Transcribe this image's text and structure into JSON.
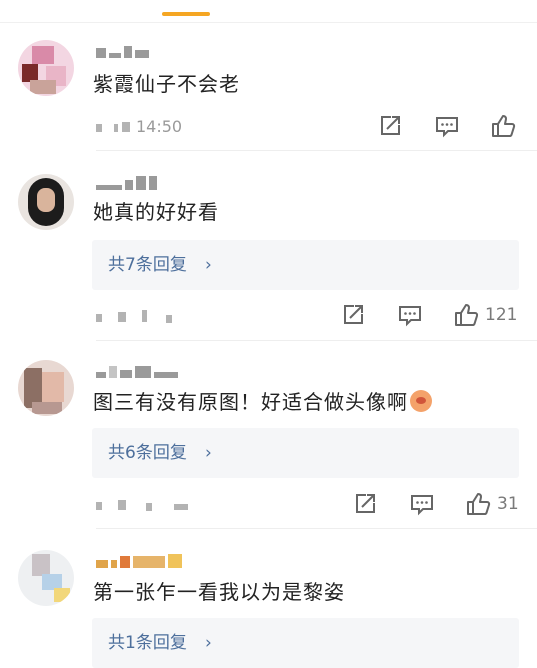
{
  "comments": [
    {
      "text": "紫霞仙子不会老",
      "time": "14:50",
      "replies_label": "",
      "likes": ""
    },
    {
      "text": "她真的好好看",
      "time": "",
      "replies_label": "共7条回复",
      "likes": "121"
    },
    {
      "text": "图三有没有原图！好适合做头像啊",
      "time": "",
      "replies_label": "共6条回复",
      "likes": "31"
    },
    {
      "text": "第一张乍一看我以为是黎姿",
      "time": "",
      "replies_label": "共1条回复",
      "likes": ""
    }
  ],
  "icons": {
    "share": "share-icon",
    "comment": "comment-icon",
    "like": "like-icon",
    "chevron": "chevron-right-icon"
  },
  "colors": {
    "accent": "#f5a623",
    "link": "#4d6f9c",
    "meta": "#9a9a9a",
    "reply_bg": "#f5f6f8"
  },
  "chevron_glyph": "›"
}
